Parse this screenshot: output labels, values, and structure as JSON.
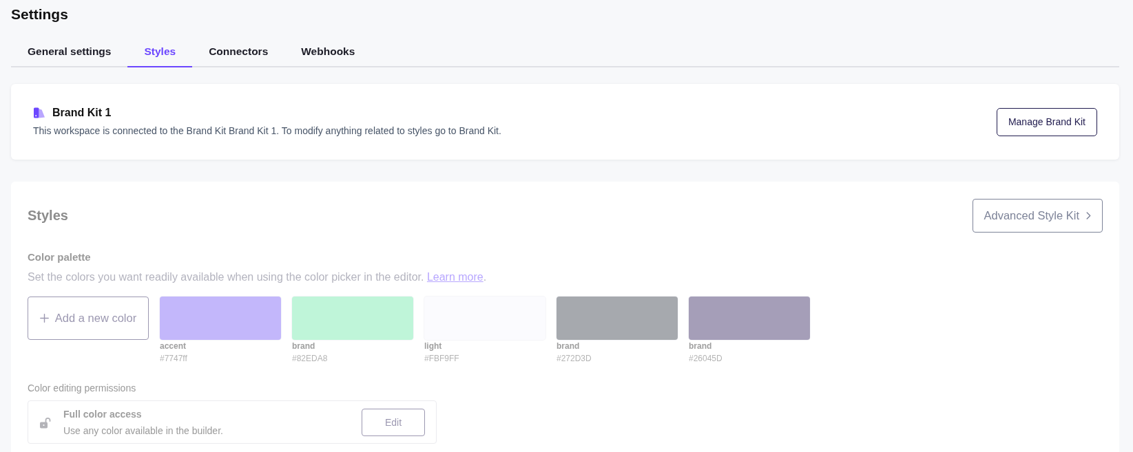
{
  "page": {
    "title": "Settings"
  },
  "tabs": [
    {
      "label": "General settings",
      "selected": false
    },
    {
      "label": "Styles",
      "selected": true
    },
    {
      "label": "Connectors",
      "selected": false
    },
    {
      "label": "Webhooks",
      "selected": false
    }
  ],
  "brand_kit": {
    "title": "Brand Kit 1",
    "description": "This workspace is connected to the Brand Kit Brand Kit 1. To modify anything related to styles go to Brand Kit.",
    "button": "Manage Brand Kit"
  },
  "styles": {
    "title": "Styles",
    "disabled": true,
    "button": "Advanced Style Kit",
    "palette": {
      "title": "Color palette",
      "description": "Set the colors you want readily available when using the color picker in the editor.",
      "link": "Learn more",
      "description_end": ".",
      "add_button": "Add a new color",
      "colors": [
        {
          "name": "accent",
          "hex": "#7747ff",
          "color": "#c3b7fb"
        },
        {
          "name": "brand",
          "hex": "#82EDA8",
          "color": "#bff5d9"
        },
        {
          "name": "light",
          "hex": "#FBF9FF",
          "color": "#fbfbfe"
        },
        {
          "name": "brand",
          "hex": "#272D3D",
          "color": "#a6a9ae"
        },
        {
          "name": "brand",
          "hex": "#26045D",
          "color": "#a59eb8"
        }
      ]
    },
    "permissions": {
      "label": "Color editing permissions",
      "title": "Full color access",
      "description": "Use any color available in the builder.",
      "button": "Edit"
    }
  }
}
